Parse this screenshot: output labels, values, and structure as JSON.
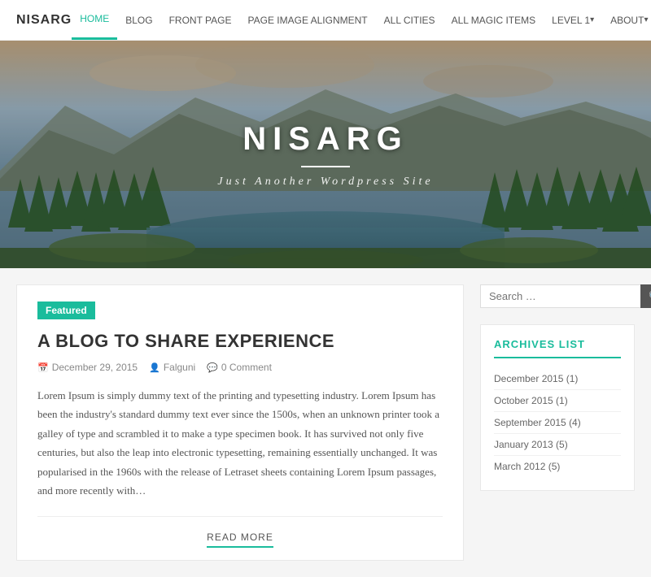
{
  "header": {
    "site_title": "NISARG",
    "nav_items": [
      {
        "label": "HOME",
        "active": true,
        "dropdown": false
      },
      {
        "label": "BLOG",
        "active": false,
        "dropdown": false
      },
      {
        "label": "FRONT PAGE",
        "active": false,
        "dropdown": false
      },
      {
        "label": "PAGE IMAGE ALIGNMENT",
        "active": false,
        "dropdown": false
      },
      {
        "label": "ALL CITIES",
        "active": false,
        "dropdown": false
      },
      {
        "label": "ALL MAGIC ITEMS",
        "active": false,
        "dropdown": false
      },
      {
        "label": "LEVEL 1",
        "active": false,
        "dropdown": true
      },
      {
        "label": "ABOUT",
        "active": false,
        "dropdown": true
      }
    ]
  },
  "hero": {
    "site_title": "NISARG",
    "tagline": "Just Another Wordpress Site"
  },
  "post": {
    "badge": "Featured",
    "title": "A BLOG TO SHARE EXPERIENCE",
    "meta_date": "December 29, 2015",
    "meta_author": "Falguni",
    "meta_comments": "0 Comment",
    "body": "Lorem Ipsum is simply dummy text of the printing and typesetting industry. Lorem Ipsum has been the industry's standard dummy text ever since the 1500s, when an unknown printer took a galley of type and scrambled it to make a type specimen book. It has survived not only five centuries, but also the leap into electronic typesetting, remaining essentially unchanged. It was popularised in the 1960s with the release of Letraset sheets containing Lorem Ipsum passages, and more recently with…",
    "read_more": "READ MORE"
  },
  "sidebar": {
    "search_placeholder": "Search …",
    "archives_title": "ARCHIVES LIST",
    "archives": [
      {
        "label": "December 2015 (1)"
      },
      {
        "label": "October 2015 (1)"
      },
      {
        "label": "September 2015 (4)"
      },
      {
        "label": "January 2013 (5)"
      },
      {
        "label": "March 2012 (5)"
      }
    ]
  },
  "colors": {
    "accent": "#1abc9c"
  }
}
